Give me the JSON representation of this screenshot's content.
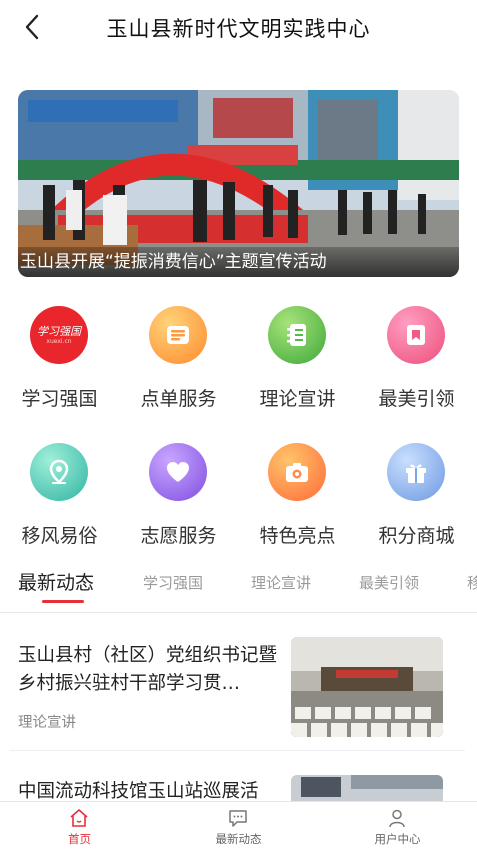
{
  "header": {
    "title": "玉山县新时代文明实践中心",
    "back_icon": "chevron-left-icon"
  },
  "banner": {
    "caption": "玉山县开展“提振消费信心”主题宣传活动"
  },
  "grid": {
    "items": [
      {
        "label": "学习强国",
        "icon": "xuexi-qiangguo-logo",
        "color": "#e8262c"
      },
      {
        "label": "点单服务",
        "icon": "order-card-icon",
        "color": "#ff9a3c"
      },
      {
        "label": "理论宣讲",
        "icon": "notebook-icon",
        "color": "#56b847"
      },
      {
        "label": "最美引领",
        "icon": "bookmark-icon",
        "color": "#f05a83"
      },
      {
        "label": "移风易俗",
        "icon": "location-pin-icon",
        "color": "#3ebfae"
      },
      {
        "label": "志愿服务",
        "icon": "heart-icon",
        "color": "#9a63e6"
      },
      {
        "label": "特色亮点",
        "icon": "camera-icon",
        "color": "#ff8a4a"
      },
      {
        "label": "积分商城",
        "icon": "gift-icon",
        "color": "#7aa8e6"
      }
    ],
    "logo_text": "学习强国",
    "logo_sub": "xuexi.cn"
  },
  "tabs": {
    "items": [
      "最新动态",
      "学习强国",
      "理论宣讲",
      "最美引领",
      "移"
    ],
    "active_color": "#e5303a"
  },
  "feed": [
    {
      "title": "玉山县村（社区）党组织书记暨乡村振兴驻村干部学习贯…",
      "category": "理论宣讲"
    },
    {
      "title": "中国流动科技馆玉山站巡展活",
      "category": ""
    }
  ],
  "bottom_nav": {
    "items": [
      {
        "label": "首页",
        "icon": "home-icon",
        "active": true
      },
      {
        "label": "最新动态",
        "icon": "chat-icon",
        "active": false
      },
      {
        "label": "用户中心",
        "icon": "user-icon",
        "active": false
      }
    ]
  }
}
